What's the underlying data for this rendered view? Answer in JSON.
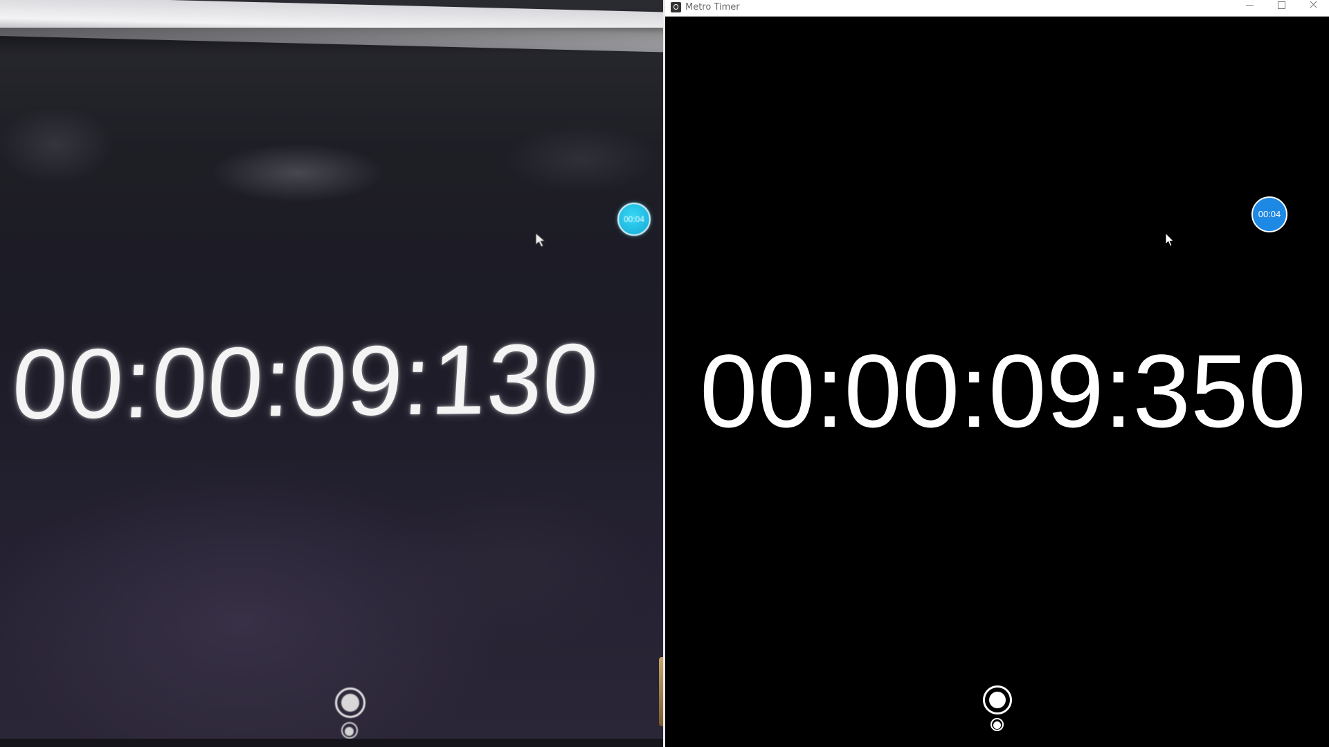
{
  "camera_view": {
    "timer_display": "00:00:09:130",
    "split_badge": "00:04",
    "icons": [
      "mouse-cursor-icon",
      "record-icon",
      "lap-icon"
    ]
  },
  "window": {
    "title": "Metro Timer",
    "controls": [
      "minimize-icon",
      "maximize-icon",
      "close-icon"
    ]
  },
  "timer": {
    "display": "00:00:09:350",
    "split_badge": "00:04"
  },
  "colors": {
    "window_background": "#000000",
    "timer_text": "#ffffff",
    "badge_accent": "#1e88e5",
    "camera_badge_accent": "#15a9d8",
    "title_bar": "#ffffff"
  },
  "icons": {
    "app": "stopwatch-icon",
    "record": "record-icon",
    "lap": "lap-icon",
    "cursor": "mouse-cursor-icon"
  }
}
